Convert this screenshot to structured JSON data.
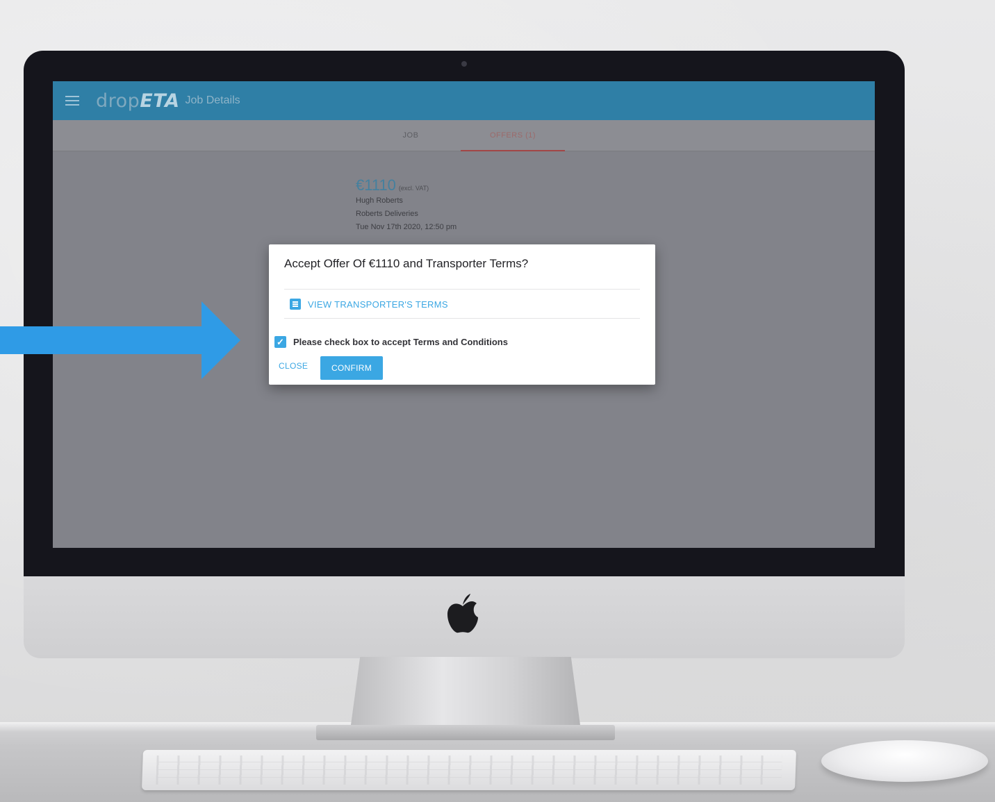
{
  "app": {
    "brand_prefix": "drop",
    "brand_suffix": "ETA",
    "header_title": "Job Details"
  },
  "tabs": [
    {
      "label": "JOB",
      "active": false
    },
    {
      "label": "OFFERS (1)",
      "active": true
    }
  ],
  "offer": {
    "price": "€1110",
    "vat_note": "(excl. VAT)",
    "name": "Hugh Roberts",
    "company": "Roberts Deliveries",
    "date": "Tue Nov 17th 2020, 12:50 pm"
  },
  "dialog": {
    "title": "Accept Offer Of €1110 and Transporter Terms?",
    "terms_link": "VIEW TRANSPORTER'S TERMS",
    "checkbox_label": "Please check box to accept Terms and Conditions",
    "checkbox_checked": true,
    "close_label": "CLOSE",
    "confirm_label": "CONFIRM"
  },
  "colors": {
    "header": "#2f7fa6",
    "accent": "#3ba7e3",
    "arrow": "#2f9be6"
  },
  "icons": [
    "menu-icon",
    "document-icon",
    "checkmark-icon",
    "apple-logo-icon",
    "arrow-right-icon"
  ]
}
